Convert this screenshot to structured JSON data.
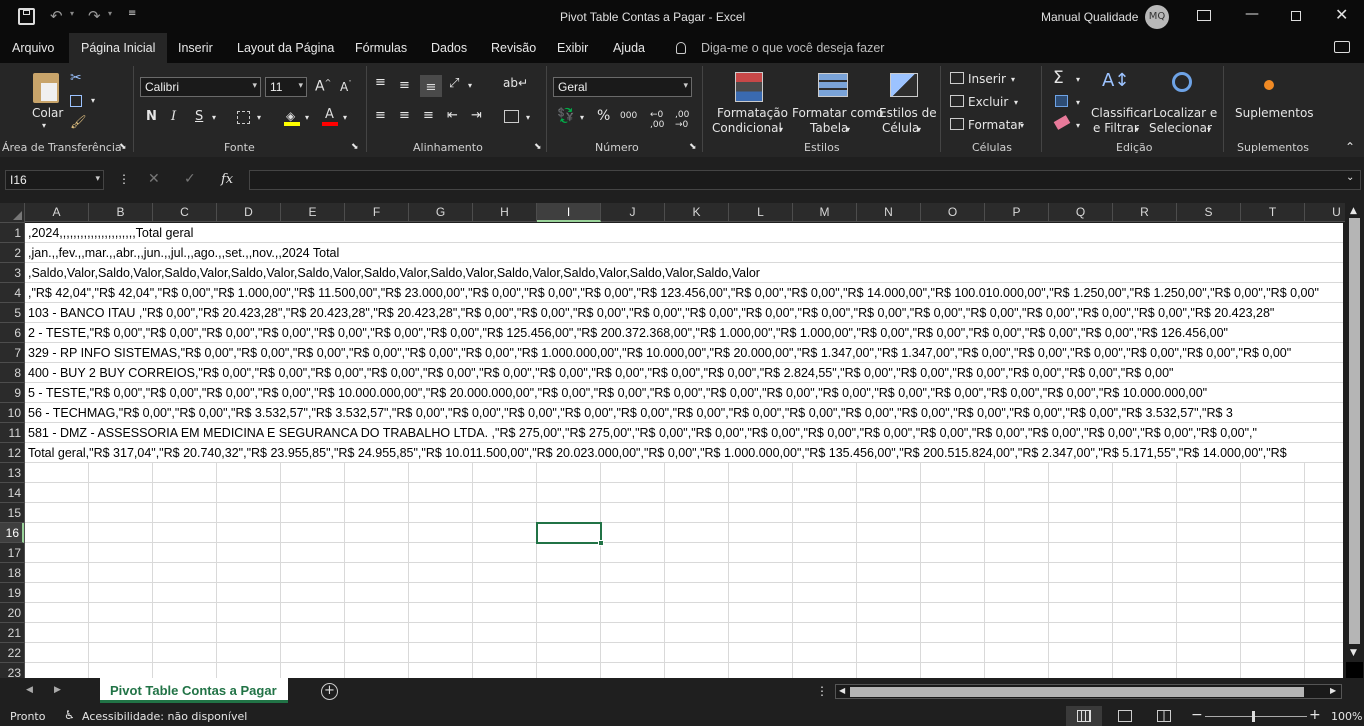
{
  "window": {
    "title": "Pivot Table Contas a Pagar  -  Excel",
    "user": "Manual Qualidade",
    "user_initials": "MQ"
  },
  "menu": {
    "tabs": [
      "Arquivo",
      "Página Inicial",
      "Inserir",
      "Layout da Página",
      "Fórmulas",
      "Dados",
      "Revisão",
      "Exibir",
      "Ajuda"
    ],
    "active": "Página Inicial",
    "tell_me": "Diga-me o que você deseja fazer"
  },
  "ribbon": {
    "clipboard": {
      "paste": "Colar",
      "group": "Área de Transferência"
    },
    "font": {
      "name": "Calibri",
      "size": "11",
      "bold": "N",
      "italic": "I",
      "underline": "S",
      "group": "Fonte"
    },
    "alignment": {
      "group": "Alinhamento"
    },
    "number": {
      "format": "Geral",
      "percent": "%",
      "thousands": "000",
      "group": "Número"
    },
    "styles": {
      "conditional_1": "Formatação",
      "conditional_2": "Condicional",
      "table_1": "Formatar como",
      "table_2": "Tabela",
      "cell_1": "Estilos de",
      "cell_2": "Célula",
      "group": "Estilos"
    },
    "cells": {
      "insert": "Inserir",
      "delete": "Excluir",
      "format": "Formatar",
      "group": "Células"
    },
    "editing": {
      "sort_1": "Classificar",
      "sort_2": "e Filtrar",
      "find_1": "Localizar e",
      "find_2": "Selecionar",
      "group": "Edição"
    },
    "addins": {
      "label": "Suplementos",
      "group": "Suplementos"
    }
  },
  "formula_bar": {
    "name_box": "I16",
    "formula": ""
  },
  "columns": [
    "A",
    "B",
    "C",
    "D",
    "E",
    "F",
    "G",
    "H",
    "I",
    "J",
    "K",
    "L",
    "M",
    "N",
    "O",
    "P",
    "Q",
    "R",
    "S",
    "T",
    "U"
  ],
  "selected_column": "I",
  "rows": [
    "1",
    "2",
    "3",
    "4",
    "5",
    "6",
    "7",
    "8",
    "9",
    "10",
    "11",
    "12",
    "13",
    "14",
    "15",
    "16",
    "17",
    "18",
    "19",
    "20",
    "21",
    "22",
    "23"
  ],
  "selected_row": "16",
  "cells": [
    ",2024,,,,,,,,,,,,,,,,,,,,,,Total geral",
    ",jan.,,fev.,,mar.,,abr.,,jun.,,jul.,,ago.,,set.,,nov.,,2024 Total",
    ",Saldo,Valor,Saldo,Valor,Saldo,Valor,Saldo,Valor,Saldo,Valor,Saldo,Valor,Saldo,Valor,Saldo,Valor,Saldo,Valor,Saldo,Valor,Saldo,Valor",
    ",\"R$ 42,04\",\"R$ 42,04\",\"R$ 0,00\",\"R$ 1.000,00\",\"R$ 11.500,00\",\"R$ 23.000,00\",\"R$ 0,00\",\"R$ 0,00\",\"R$ 0,00\",\"R$ 123.456,00\",\"R$ 0,00\",\"R$ 0,00\",\"R$ 14.000,00\",\"R$ 100.010.000,00\",\"R$ 1.250,00\",\"R$ 1.250,00\",\"R$ 0,00\",\"R$ 0,00\"",
    "103 - BANCO ITAU ,\"R$ 0,00\",\"R$ 20.423,28\",\"R$ 20.423,28\",\"R$ 20.423,28\",\"R$ 0,00\",\"R$ 0,00\",\"R$ 0,00\",\"R$ 0,00\",\"R$ 0,00\",\"R$ 0,00\",\"R$ 0,00\",\"R$ 0,00\",\"R$ 0,00\",\"R$ 0,00\",\"R$ 0,00\",\"R$ 0,00\",\"R$ 0,00\",\"R$ 20.423,28\"",
    "2 - TESTE,\"R$ 0,00\",\"R$ 0,00\",\"R$ 0,00\",\"R$ 0,00\",\"R$ 0,00\",\"R$ 0,00\",\"R$ 0,00\",\"R$ 125.456,00\",\"R$ 200.372.368,00\",\"R$ 1.000,00\",\"R$ 1.000,00\",\"R$ 0,00\",\"R$ 0,00\",\"R$ 0,00\",\"R$ 0,00\",\"R$ 0,00\",\"R$ 126.456,00\"",
    "329 - RP INFO SISTEMAS,\"R$ 0,00\",\"R$ 0,00\",\"R$ 0,00\",\"R$ 0,00\",\"R$ 0,00\",\"R$ 0,00\",\"R$ 1.000.000,00\",\"R$ 10.000,00\",\"R$ 20.000,00\",\"R$ 1.347,00\",\"R$ 1.347,00\",\"R$ 0,00\",\"R$ 0,00\",\"R$ 0,00\",\"R$ 0,00\",\"R$ 0,00\",\"R$ 0,00\"",
    "400 - BUY 2 BUY CORREIOS,\"R$ 0,00\",\"R$ 0,00\",\"R$ 0,00\",\"R$ 0,00\",\"R$ 0,00\",\"R$ 0,00\",\"R$ 0,00\",\"R$ 0,00\",\"R$ 0,00\",\"R$ 0,00\",\"R$ 2.824,55\",\"R$ 0,00\",\"R$ 0,00\",\"R$ 0,00\",\"R$ 0,00\",\"R$ 0,00\",\"R$ 0,00\"",
    "5 - TESTE,\"R$ 0,00\",\"R$ 0,00\",\"R$ 0,00\",\"R$ 0,00\",\"R$ 10.000.000,00\",\"R$ 20.000.000,00\",\"R$ 0,00\",\"R$ 0,00\",\"R$ 0,00\",\"R$ 0,00\",\"R$ 0,00\",\"R$ 0,00\",\"R$ 0,00\",\"R$ 0,00\",\"R$ 0,00\",\"R$ 0,00\",\"R$ 10.000.000,00\"",
    "56 - TECHMAG,\"R$ 0,00\",\"R$ 0,00\",\"R$ 3.532,57\",\"R$ 3.532,57\",\"R$ 0,00\",\"R$ 0,00\",\"R$ 0,00\",\"R$ 0,00\",\"R$ 0,00\",\"R$ 0,00\",\"R$ 0,00\",\"R$ 0,00\",\"R$ 0,00\",\"R$ 0,00\",\"R$ 0,00\",\"R$ 0,00\",\"R$ 0,00\",\"R$ 3.532,57\",\"R$ 3",
    "581 - DMZ - ASSESSORIA EM MEDICINA E SEGURANCA DO TRABALHO LTDA. ,\"R$ 275,00\",\"R$ 275,00\",\"R$ 0,00\",\"R$ 0,00\",\"R$ 0,00\",\"R$ 0,00\",\"R$ 0,00\",\"R$ 0,00\",\"R$ 0,00\",\"R$ 0,00\",\"R$ 0,00\",\"R$ 0,00\",\"R$ 0,00\",\"",
    "Total geral,\"R$ 317,04\",\"R$ 20.740,32\",\"R$ 23.955,85\",\"R$ 24.955,85\",\"R$ 10.011.500,00\",\"R$ 20.023.000,00\",\"R$ 0,00\",\"R$ 1.000.000,00\",\"R$ 135.456,00\",\"R$ 200.515.824,00\",\"R$ 2.347,00\",\"R$ 5.171,55\",\"R$ 14.000,00\",\"R$"
  ],
  "sheet_tab": "Pivot Table Contas a Pagar",
  "status": {
    "mode": "Pronto",
    "accessibility": "Acessibilidade: não disponível",
    "zoom": "100%",
    "zoom_minus": "−",
    "zoom_plus": "+"
  },
  "colors": {
    "accent_green": "#9ad39a",
    "tab_green": "#9ad39a"
  }
}
